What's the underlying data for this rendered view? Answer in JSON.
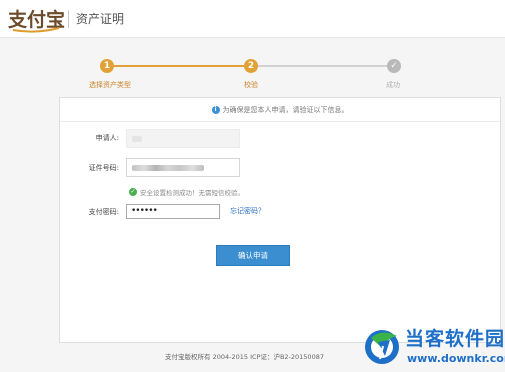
{
  "header": {
    "logo_text": "支付宝",
    "title": "资产证明"
  },
  "steps": [
    {
      "number": "1",
      "label": "选择资产类型",
      "state": "done"
    },
    {
      "number": "2",
      "label": "校验",
      "state": "current"
    },
    {
      "number": "✓",
      "label": "成功",
      "state": "pending"
    }
  ],
  "notice": "为确保是您本人申请，请验证以下信息。",
  "form": {
    "applicant_label": "申请人:",
    "id_label": "证件号码:",
    "security_ok_text": "安全设置检测成功！无需短信校验。",
    "password_label": "支付密码:",
    "password_value": "••••••",
    "forgot_link": "忘记密码？",
    "submit_label": "确认申请"
  },
  "footer": "支付宝版权所有 2004-2015 ICP证：沪B2-20150087",
  "watermark": {
    "title": "当客软件园",
    "url": "www.downkr.com"
  },
  "colors": {
    "step_active": "#e2a137",
    "step_inactive": "#b9b9b9",
    "primary_button": "#3b8fd0",
    "link": "#2a6fc4",
    "success": "#4caf50"
  }
}
